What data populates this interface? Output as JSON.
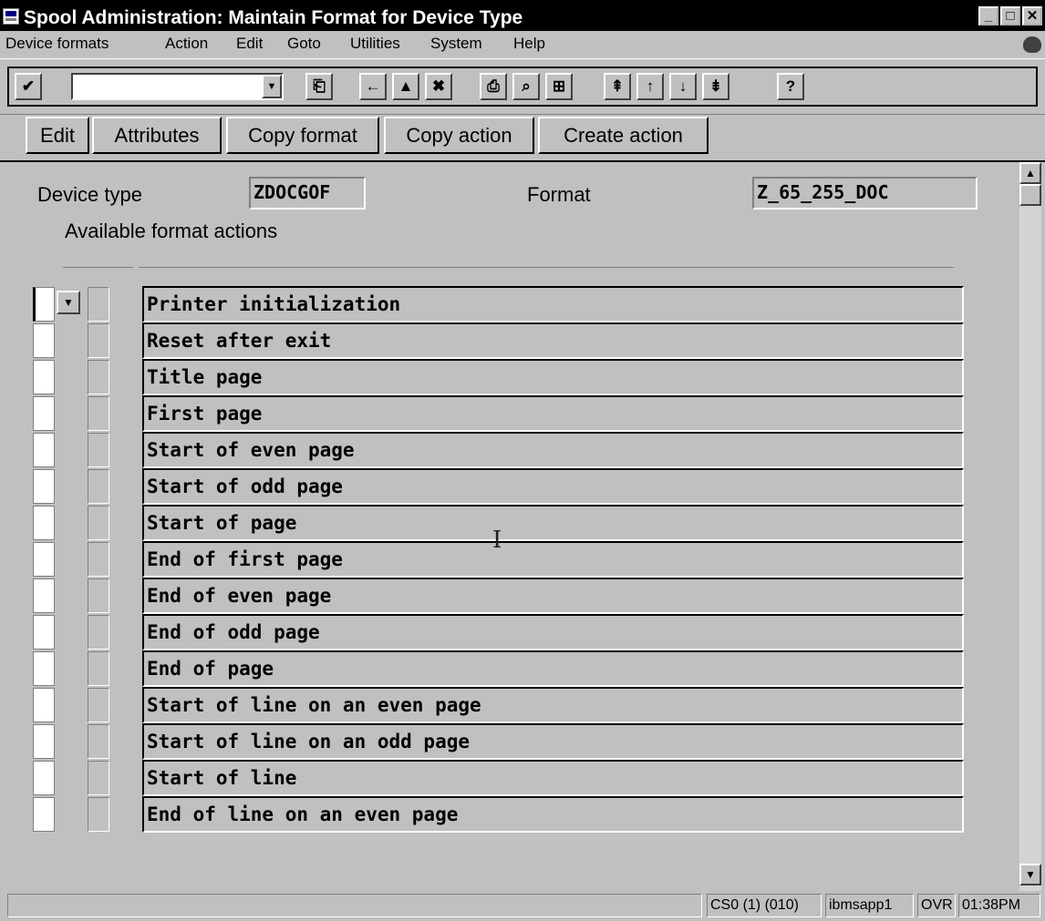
{
  "window": {
    "title": "Spool Administration: Maintain Format for Device Type"
  },
  "menu": [
    "Device formats",
    "Action",
    "Edit",
    "Goto",
    "Utilities",
    "System",
    "Help"
  ],
  "toolbar": {
    "command_value": ""
  },
  "app_buttons": [
    "Edit",
    "Attributes",
    "Copy format",
    "Copy action",
    "Create action"
  ],
  "header": {
    "device_type_label": "Device type",
    "device_type_value": "ZDOCGOF",
    "format_label": "Format",
    "format_value": "Z_65_255_DOC",
    "section_title": "Available format actions"
  },
  "actions": [
    "Printer initialization",
    "Reset after exit",
    "Title page",
    "First page",
    "Start of even page",
    "Start of odd page",
    "Start of page",
    "End of first page",
    "End of even page",
    "End of odd page",
    "End of page",
    "Start of line on an even page",
    "Start of line on an odd page",
    "Start of line",
    "End of line on an even page"
  ],
  "status": {
    "system": "CS0 (1) (010)",
    "server": "ibmsapp1",
    "mode": "OVR",
    "time": "01:38PM"
  }
}
